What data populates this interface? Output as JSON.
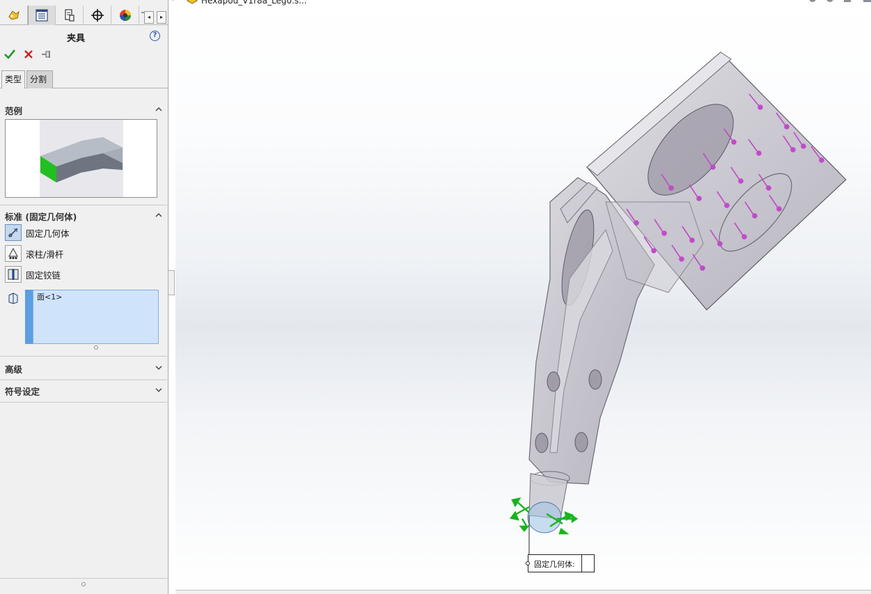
{
  "document": {
    "title": "Hexapod_V1r8a_Leg0.s..."
  },
  "manager_tabs": [
    {
      "name": "feature-manager-tab"
    },
    {
      "name": "property-manager-tab"
    },
    {
      "name": "configuration-manager-tab"
    },
    {
      "name": "dimxpert-manager-tab"
    },
    {
      "name": "display-manager-tab"
    }
  ],
  "property_manager": {
    "title": "夹具",
    "help_label": "?",
    "type_tabs": [
      "类型",
      "分割"
    ],
    "sections": {
      "example": "范例",
      "standard": "标准 (固定几何体)",
      "advanced": "高级",
      "symbol": "符号设定"
    },
    "fixture_types": [
      "固定几何体",
      "滚柱/滑杆",
      "固定铰链"
    ],
    "selection_items": [
      "面<1>"
    ]
  },
  "annotation": {
    "label": "固定几何体:"
  },
  "colors": {
    "accent": "#5b9fe3",
    "fixture_green": "#18b41c",
    "load_magenta": "#c04bc9",
    "selection_bg": "#cfe4fb"
  }
}
